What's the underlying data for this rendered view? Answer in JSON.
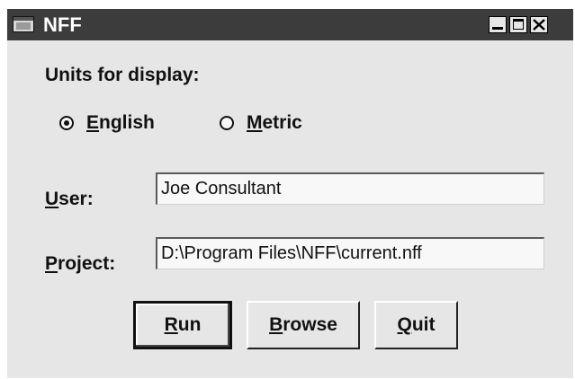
{
  "window": {
    "title": "NFF"
  },
  "units": {
    "label": "Units for display:",
    "options": [
      {
        "mnemonic": "E",
        "rest": "nglish",
        "selected": true
      },
      {
        "mnemonic": "M",
        "rest": "etric",
        "selected": false
      }
    ]
  },
  "user": {
    "mnemonic": "U",
    "rest": "ser:",
    "value": "Joe Consultant"
  },
  "project": {
    "mnemonic": "P",
    "rest": "roject:",
    "value": "D:\\Program Files\\NFF\\current.nff"
  },
  "buttons": {
    "run": {
      "mnemonic": "R",
      "rest": "un"
    },
    "browse": {
      "mnemonic": "B",
      "rest": "rowse"
    },
    "quit": {
      "mnemonic": "Q",
      "rest": "uit"
    }
  }
}
